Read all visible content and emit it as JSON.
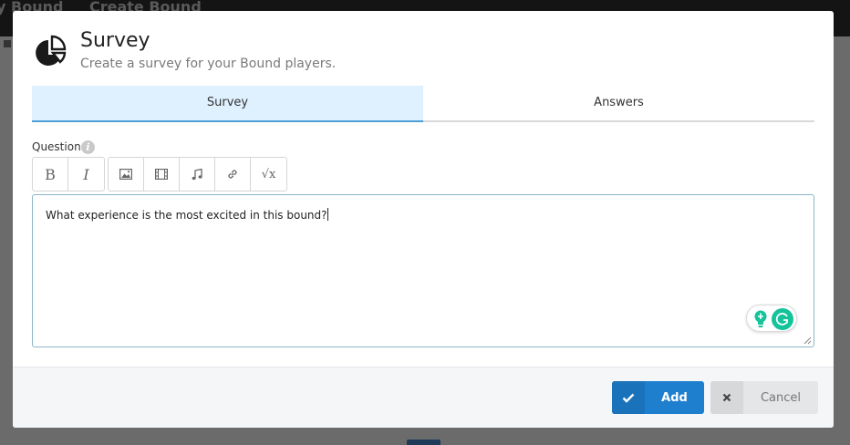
{
  "background": {
    "topbar_items": [
      "y Bound",
      "Create Bound"
    ]
  },
  "modal": {
    "title": "Survey",
    "subtitle": "Create a survey for your Bound players.",
    "header_icon": "pie-chart-icon",
    "tabs": [
      {
        "label": "Survey",
        "active": true
      },
      {
        "label": "Answers",
        "active": false
      }
    ],
    "question": {
      "label": "Question",
      "info_icon": "i",
      "toolbar": {
        "format": [
          {
            "name": "bold",
            "glyph": "B"
          },
          {
            "name": "italic",
            "glyph": "I"
          }
        ],
        "insert": [
          {
            "name": "image-icon"
          },
          {
            "name": "video-icon"
          },
          {
            "name": "music-icon"
          },
          {
            "name": "link-icon"
          },
          {
            "name": "math-icon",
            "glyph": "√x"
          }
        ]
      },
      "value": "What experience is the most excited in this bound?"
    },
    "footer": {
      "add_label": "Add",
      "cancel_label": "Cancel"
    }
  },
  "colors": {
    "accent": "#1e7fcf",
    "tab_active_bg": "#dff0ff",
    "tab_active_border": "#4b9fd5",
    "grammar": "#15c39a"
  }
}
